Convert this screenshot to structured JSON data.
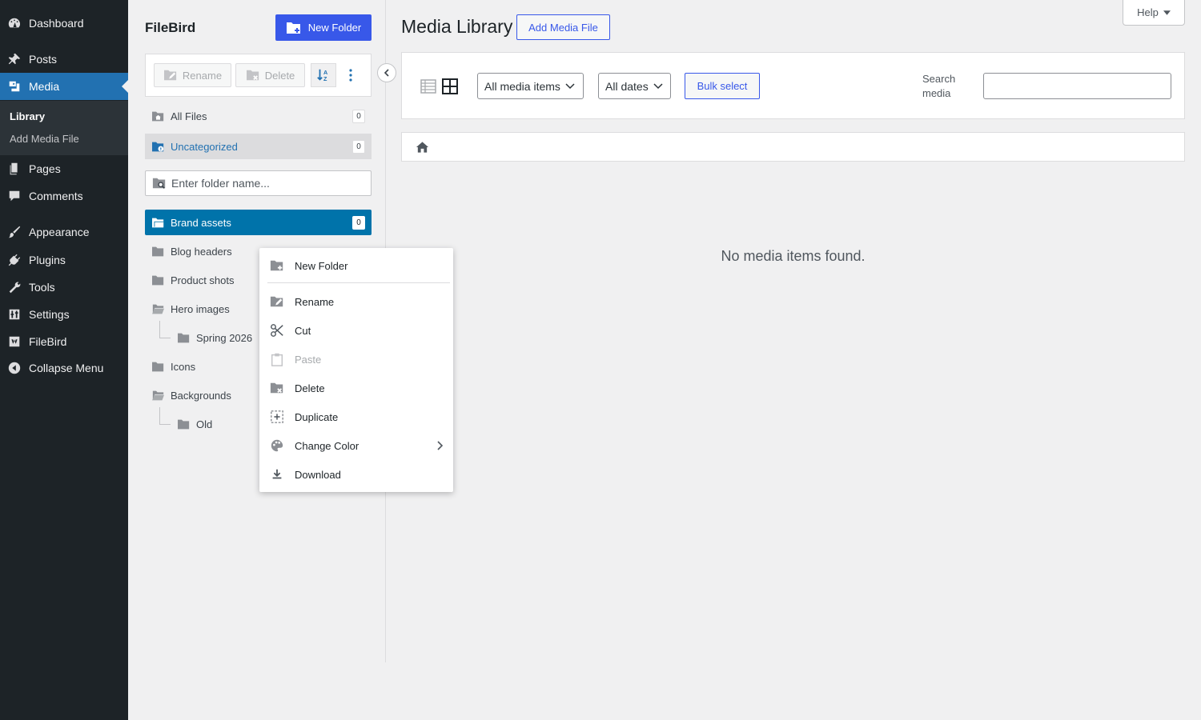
{
  "admin_menu": {
    "items": [
      {
        "label": "Dashboard",
        "icon": "dashboard-icon"
      },
      {
        "label": "Posts",
        "icon": "pin-icon"
      },
      {
        "label": "Media",
        "icon": "media-icon"
      },
      {
        "label": "Pages",
        "icon": "pages-icon"
      },
      {
        "label": "Comments",
        "icon": "comment-icon"
      },
      {
        "label": "Appearance",
        "icon": "brush-icon"
      },
      {
        "label": "Plugins",
        "icon": "plug-icon"
      },
      {
        "label": "Tools",
        "icon": "wrench-icon"
      },
      {
        "label": "Settings",
        "icon": "settings-icon"
      },
      {
        "label": "FileBird",
        "icon": "filebird-icon"
      },
      {
        "label": "Collapse Menu",
        "icon": "collapse-icon"
      }
    ],
    "submenu": [
      "Library",
      "Add Media File"
    ],
    "accent": "#2271b1"
  },
  "filebird": {
    "title": "FileBird",
    "new_folder_label": "New Folder",
    "toolbar": {
      "rename": "Rename",
      "delete": "Delete"
    },
    "special": [
      {
        "label": "All Files",
        "count": "0"
      },
      {
        "label": "Uncategorized",
        "count": "0"
      }
    ],
    "search_placeholder": "Enter folder name...",
    "folders": [
      {
        "label": "Brand assets",
        "count": "0"
      },
      {
        "label": "Blog headers"
      },
      {
        "label": "Product shots"
      },
      {
        "label": "Hero images"
      },
      {
        "label": "Spring 2026"
      },
      {
        "label": "Icons"
      },
      {
        "label": "Backgrounds"
      },
      {
        "label": "Old"
      }
    ]
  },
  "main": {
    "title": "Media Library",
    "add_button": "Add Media File",
    "help": "Help",
    "filter_type": "All media items",
    "filter_date": "All dates",
    "bulk_select": "Bulk select",
    "search_label": "Search media",
    "empty_message": "No media items found."
  },
  "context_menu": {
    "items": [
      {
        "label": "New Folder",
        "icon": "folder-plus-icon"
      },
      {
        "label": "Rename",
        "icon": "rename-icon"
      },
      {
        "label": "Cut",
        "icon": "scissors-icon"
      },
      {
        "label": "Paste",
        "icon": "clipboard-icon"
      },
      {
        "label": "Delete",
        "icon": "folder-delete-icon"
      },
      {
        "label": "Duplicate",
        "icon": "duplicate-icon"
      },
      {
        "label": "Change Color",
        "icon": "palette-icon"
      },
      {
        "label": "Download",
        "icon": "download-icon"
      }
    ]
  }
}
